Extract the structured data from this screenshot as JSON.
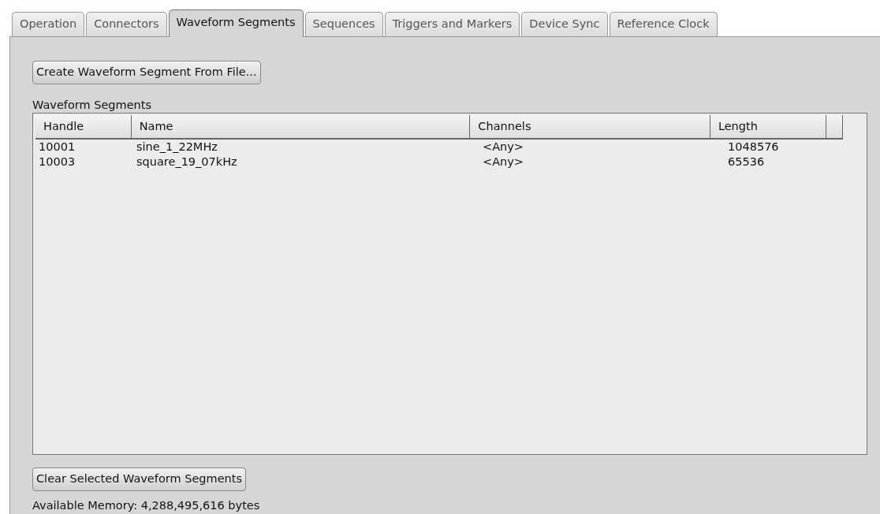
{
  "tabs": [
    {
      "label": "Operation",
      "selected": false
    },
    {
      "label": "Connectors",
      "selected": false
    },
    {
      "label": "Waveform Segments",
      "selected": true
    },
    {
      "label": "Sequences",
      "selected": false
    },
    {
      "label": "Triggers and Markers",
      "selected": false
    },
    {
      "label": "Device Sync",
      "selected": false
    },
    {
      "label": "Reference Clock",
      "selected": false
    }
  ],
  "create_button": "Create Waveform Segment From File...",
  "table_label": "Waveform Segments",
  "table": {
    "columns": [
      "Handle",
      "Name",
      "Channels",
      "Length"
    ],
    "rows": [
      [
        "10001",
        "sine_1_22MHz",
        "<Any>",
        "1048576"
      ],
      [
        "10003",
        "square_19_07kHz",
        "<Any>",
        "65536"
      ]
    ]
  },
  "clear_button": "Clear Selected Waveform Segments",
  "status": "Available Memory: 4,288,495,616 bytes"
}
